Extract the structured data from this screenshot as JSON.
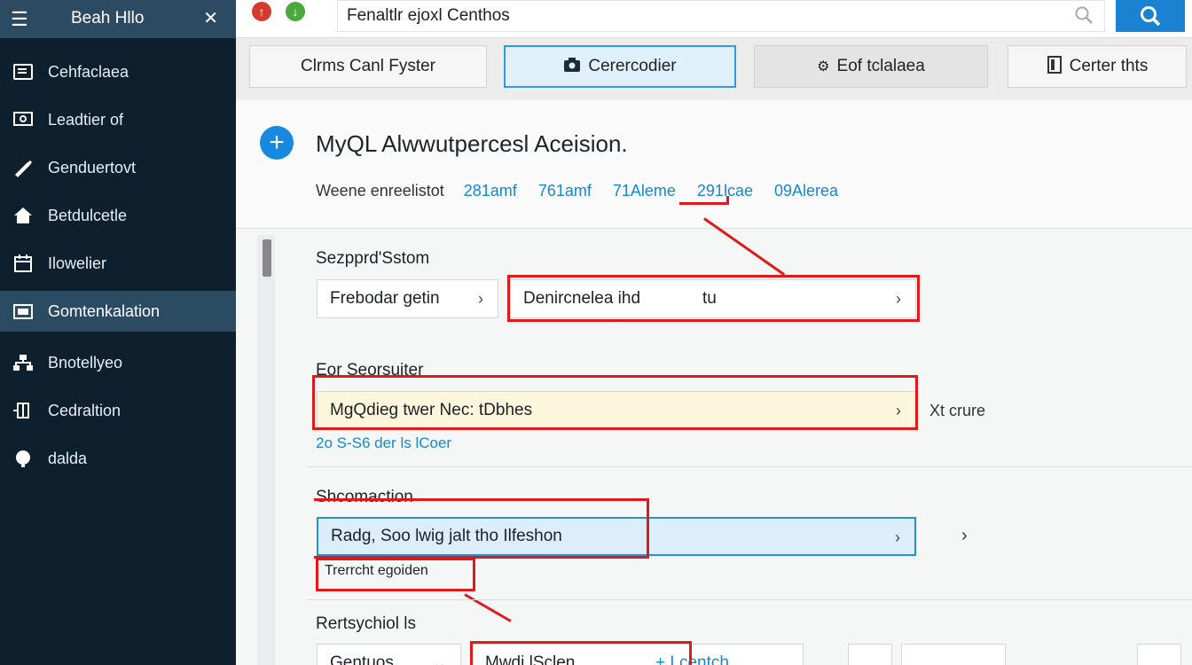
{
  "sidebar": {
    "title": "Beah Hllo",
    "items": [
      {
        "label": "Cehfaclaea",
        "icon": "list-icon"
      },
      {
        "label": "Leadtier of",
        "icon": "screen-icon"
      },
      {
        "label": "Genduertovt",
        "icon": "wrench-icon"
      },
      {
        "label": "Betdulcetle",
        "icon": "home-icon"
      },
      {
        "label": "Ilowelier",
        "icon": "calendar-icon"
      },
      {
        "label": "Gomtenkalation",
        "icon": "folder-icon"
      },
      {
        "label": "Bnotellyeo",
        "icon": "sitemap-icon"
      },
      {
        "label": "Cedraltion",
        "icon": "plugin-icon"
      },
      {
        "label": "dalda",
        "icon": "globe-icon"
      }
    ],
    "active_index": 5
  },
  "topbar": {
    "address": "Fenaltlr ejoxl Centhos"
  },
  "tabs": [
    {
      "label": "Clrms Canl Fyster",
      "icon": ""
    },
    {
      "label": "Cerercodier",
      "icon": "camera-icon"
    },
    {
      "label": "Eof tclalaea",
      "icon": "gear-icon"
    },
    {
      "label": "Certer thts",
      "icon": "document-icon"
    }
  ],
  "header": {
    "title": "MyQL Alwwutpercesl Aceision.",
    "stats_label": "Weene enreelistot",
    "stats": [
      "281amf",
      "761amf",
      "71Aleme",
      "291lcae",
      "09Alerea"
    ]
  },
  "section1": {
    "label": "Sezpprd'Sstom",
    "field_a": "Frebodar getin",
    "field_b": "Denircnelea ihd",
    "field_b_suffix": "tu"
  },
  "section2": {
    "label": "Eor Seorsuiter",
    "field": "MgQdieg twer Nec: tDbhes",
    "side": "Xt crure",
    "hint": "2o S-S6 der ls lCoer"
  },
  "section3": {
    "label": "Shcomaction",
    "field": "Radg, Soo lwig jalt tho Ilfeshon",
    "hint": "Trerrcht egoiden"
  },
  "section4": {
    "label": "Rertsychiol ls",
    "select": "Gentuos",
    "field": "Mwdi lSclen",
    "action": "+ Lcentch"
  },
  "colors": {
    "sidebar_bg": "#0e1f2e",
    "sidebar_active": "#2b4b63",
    "accent": "#1789de",
    "annotation_red": "#e01a1a",
    "highlight_yellow": "#fbf6dc",
    "highlight_blue": "#dcedfb"
  }
}
